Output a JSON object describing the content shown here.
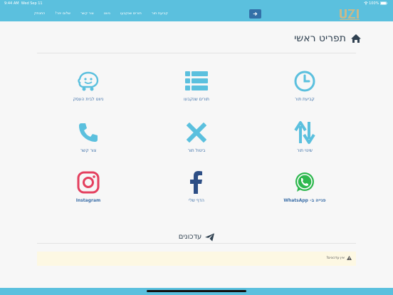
{
  "status": {
    "time": "9:44 AM",
    "date": "Wed Sep 11",
    "battery": "100%"
  },
  "nav": {
    "links": [
      "קביעת תור",
      "תורים שנקבעו",
      "ניווט",
      "צור קשר",
      "שלום יוזר!",
      "התנתק"
    ],
    "button_icon": "arrow-right-icon"
  },
  "page_title": "תפריט ראשי",
  "tiles": [
    {
      "label": "קביעת תור",
      "icon": "clock-icon"
    },
    {
      "label": "תורים שנקבעו",
      "icon": "list-icon"
    },
    {
      "label": "ניווט לבית העסק",
      "icon": "waze-icon"
    },
    {
      "label": "שינוי תור",
      "icon": "swap-arrows-icon"
    },
    {
      "label": "ביטול תור",
      "icon": "cancel-x-icon"
    },
    {
      "label": "צור קשר",
      "icon": "phone-icon"
    },
    {
      "label": "פנייה ב- WhatsApp",
      "icon": "whatsapp-icon"
    },
    {
      "label": "הדף שלי",
      "icon": "facebook-icon"
    },
    {
      "label": "Instagram",
      "icon": "instagram-icon"
    }
  ],
  "updates_title": "עדכונים",
  "alert_text": "אין עדכונים!",
  "colors": {
    "nav": "#5bc0de",
    "accent": "#3c6fa8",
    "icon_blue": "#5bc0de",
    "whatsapp": "#2fb84f",
    "facebook": "#2d4e85",
    "instagram": "#e4405f"
  }
}
